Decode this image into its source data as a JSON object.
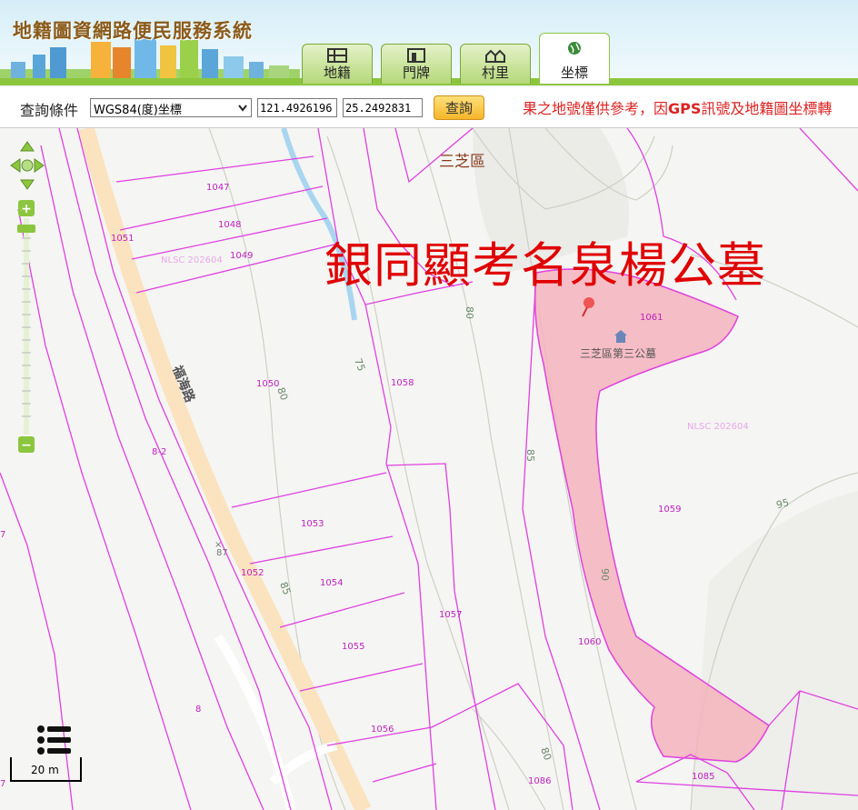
{
  "header": {
    "title": "地籍圖資網路便民服務系統",
    "tabs": [
      {
        "label": "地籍",
        "icon": "map-grid-icon",
        "active": false
      },
      {
        "label": "門牌",
        "icon": "door-plate-icon",
        "active": false
      },
      {
        "label": "村里",
        "icon": "village-houses-icon",
        "active": false
      },
      {
        "label": "坐標",
        "icon": "globe-icon",
        "active": true
      }
    ]
  },
  "toolbar": {
    "query_label": "查詢條件",
    "coord_system": "WGS84(度)坐標",
    "longitude": "121.4926196",
    "latitude": "25.2492831",
    "query_button": "查詢",
    "notice_prefix": "果之地號僅供參考，因",
    "notice_gps": "GPS",
    "notice_suffix": "訊號及地籍圖坐標轉"
  },
  "map": {
    "district_label": "三芝區",
    "road_label": "福海路",
    "cemetery_label": "三芝區第三公墓",
    "watermark": "銀同顯考名泉楊公墓",
    "nlsc_labels": [
      "NLSC 202604",
      "NLSC 202604"
    ],
    "parcels": [
      "1047",
      "1048",
      "1049",
      "1051",
      "1050",
      "1058",
      "1061",
      "1053",
      "1052",
      "1054",
      "1055",
      "1057",
      "1056",
      "1059",
      "1060",
      "1086",
      "1085",
      "8-2",
      "8",
      "7",
      "7"
    ],
    "contours": [
      "75",
      "80",
      "80",
      "85",
      "85",
      "90",
      "95",
      "80"
    ],
    "spot_height": "87",
    "scale": "20 m",
    "colors": {
      "parcel_line": "#e040e0",
      "highlight_fill": "#f4b3bc",
      "watermark": "#e00000",
      "water": "#a8d6f0",
      "road": "#fbe3c0"
    }
  }
}
